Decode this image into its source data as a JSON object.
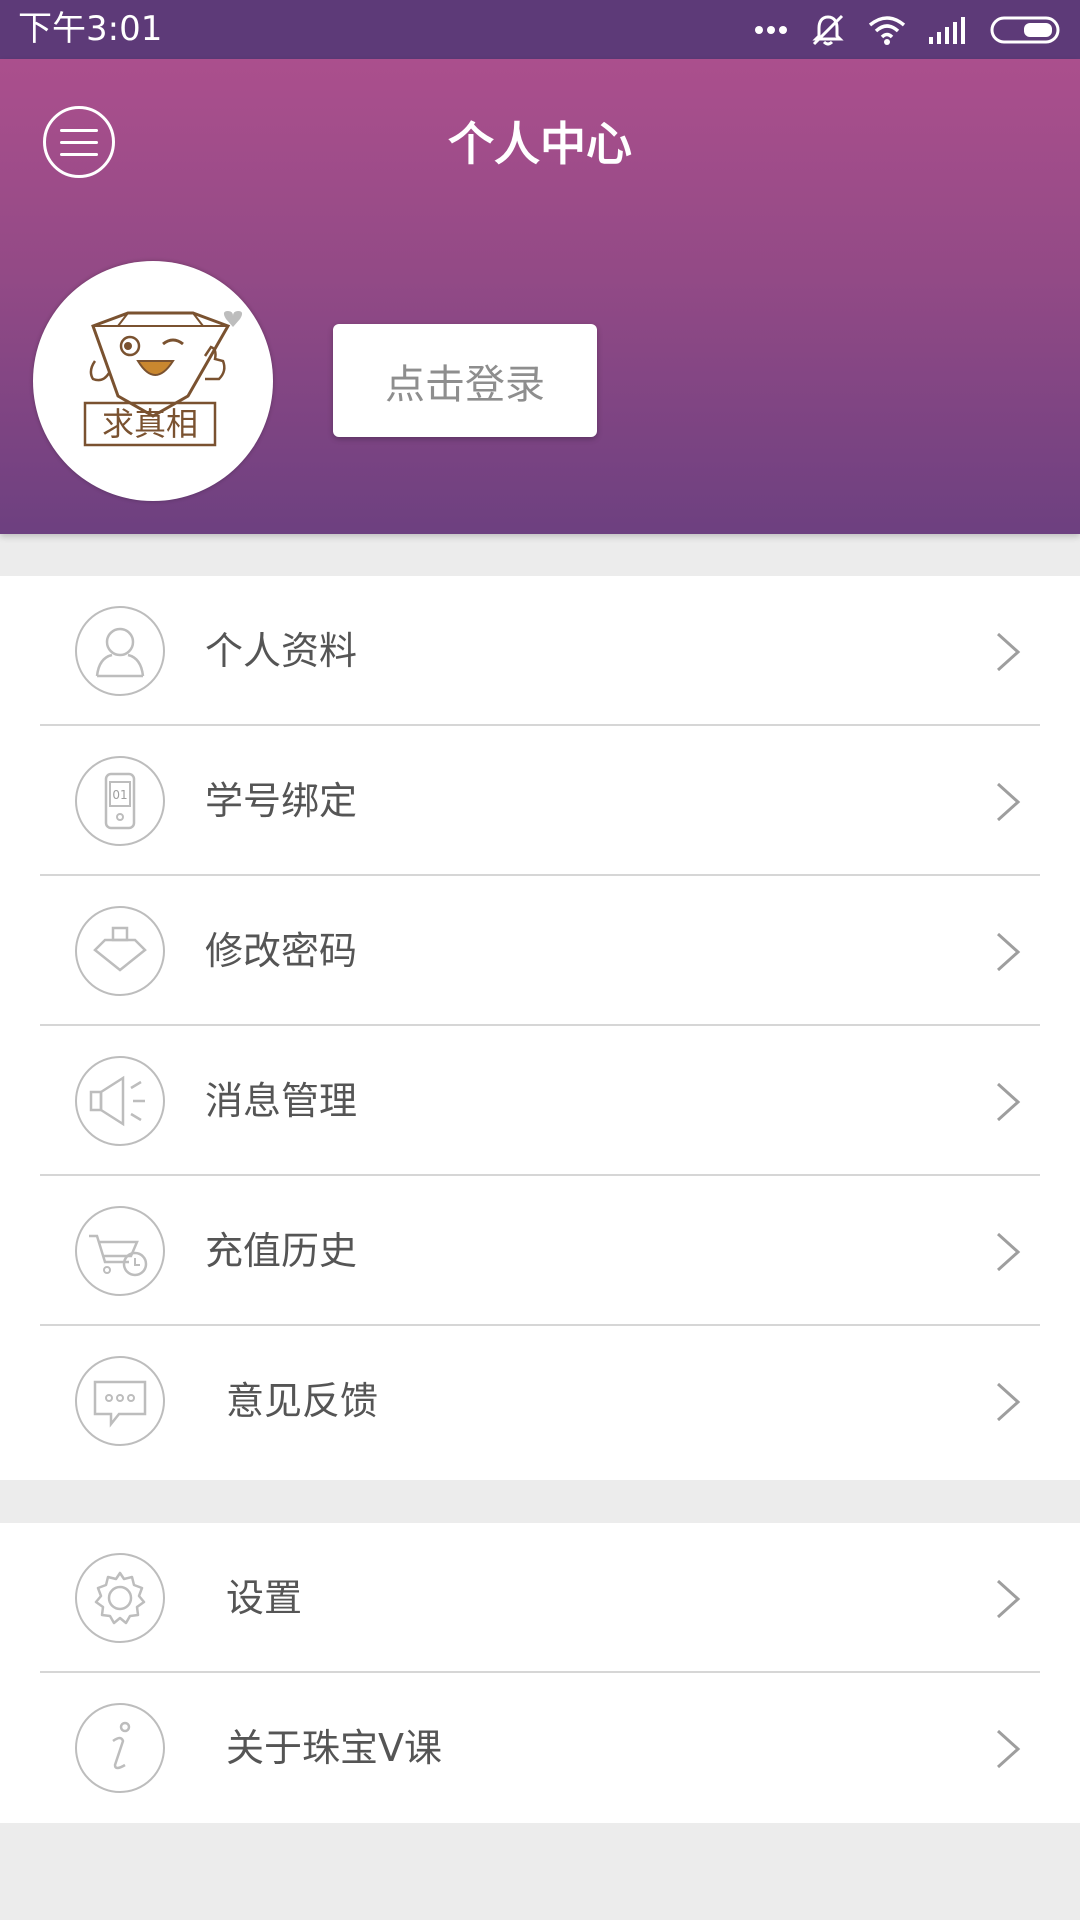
{
  "status_bar": {
    "time": "下午3:01",
    "icons": [
      "more-dots-icon",
      "mute-bell-icon",
      "wifi-icon",
      "signal-icon",
      "battery-icon"
    ]
  },
  "header": {
    "title": "个人中心",
    "avatar_text": "求真相",
    "login_label": "点击登录"
  },
  "menu": {
    "group1": [
      {
        "label": "个人资料",
        "icon": "person-icon"
      },
      {
        "label": "学号绑定",
        "icon": "phone-id-icon"
      },
      {
        "label": "修改密码",
        "icon": "lock-icon"
      },
      {
        "label": "消息管理",
        "icon": "megaphone-icon"
      },
      {
        "label": "充值历史",
        "icon": "cart-clock-icon"
      },
      {
        "label": "意见反馈",
        "icon": "chat-bubble-icon"
      }
    ],
    "group2": [
      {
        "label": "设置",
        "icon": "gear-icon"
      },
      {
        "label": "关于珠宝V课",
        "icon": "info-icon"
      }
    ]
  },
  "colors": {
    "status_bar": "#5d3a78",
    "header_top": "#ab4f8d",
    "header_bottom": "#6d4080",
    "background": "#ececec",
    "text": "#555555",
    "icon_stroke": "#bdbdbd"
  }
}
